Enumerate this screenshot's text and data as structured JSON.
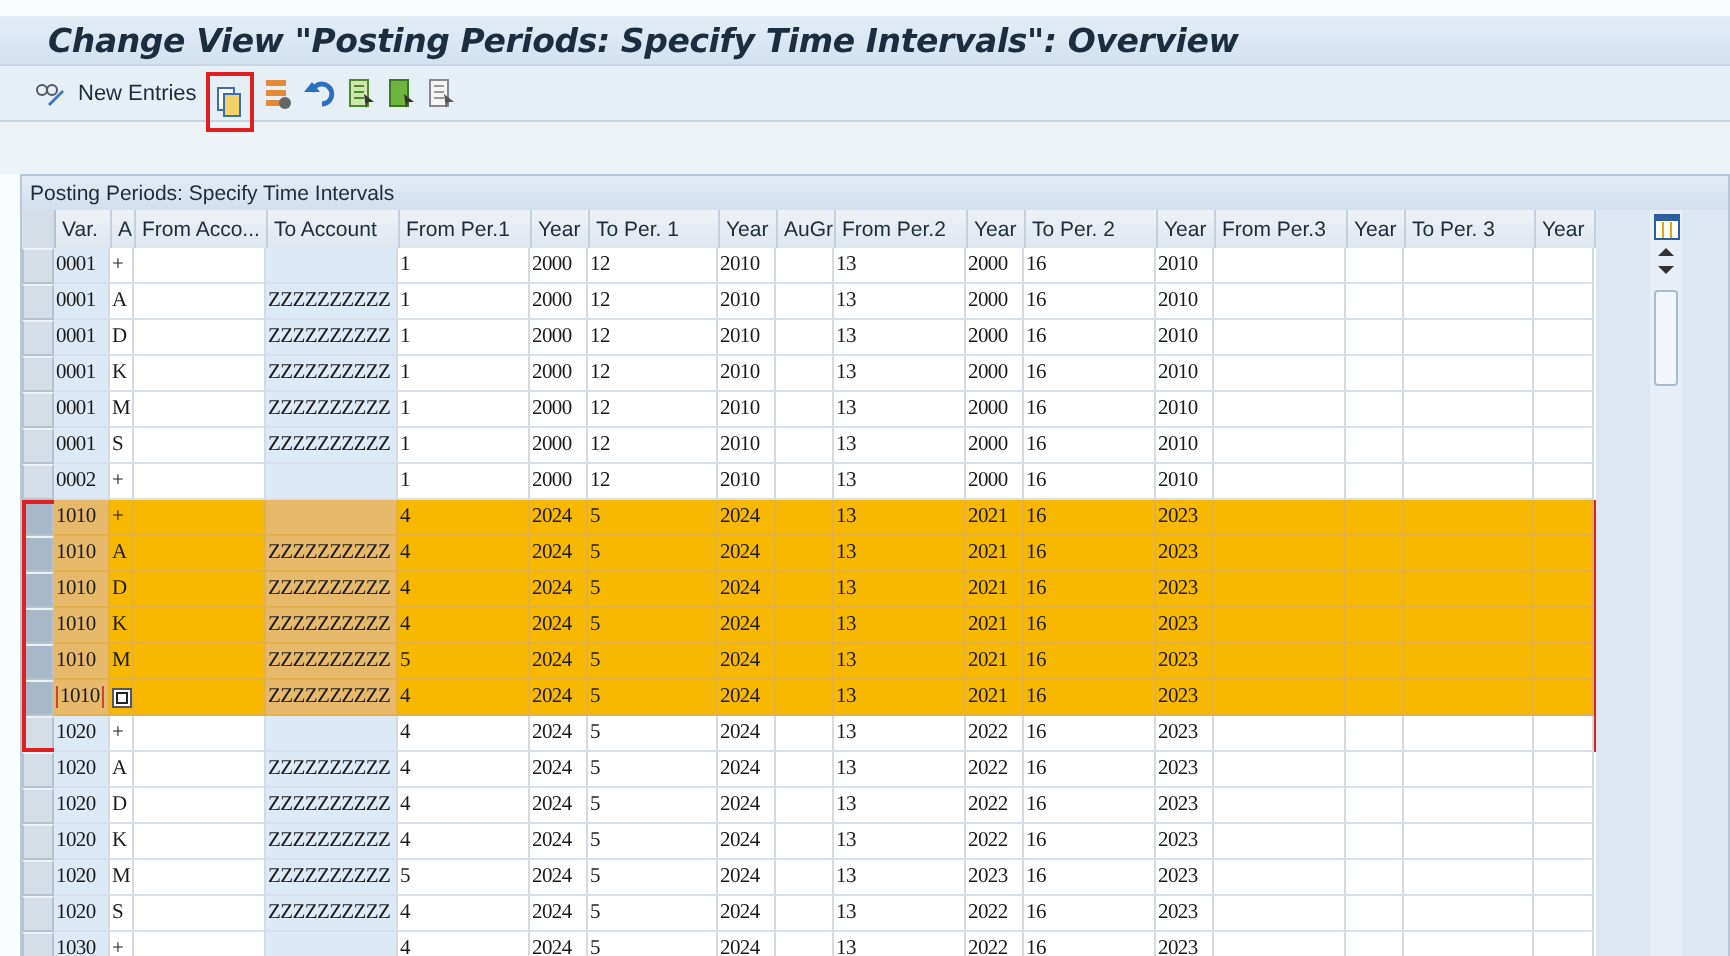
{
  "window": {
    "title": "Change View \"Posting Periods: Specify Time Intervals\": Overview"
  },
  "toolbar": {
    "buttons": [
      {
        "kind": "toggle",
        "highlighted": false
      },
      {
        "kind": "text",
        "label": "New Entries",
        "highlighted": false
      },
      {
        "kind": "copy",
        "highlighted": true
      },
      {
        "kind": "delete",
        "highlighted": false
      },
      {
        "kind": "undo",
        "highlighted": false
      },
      {
        "kind": "select_all",
        "highlighted": false
      },
      {
        "kind": "select_block",
        "highlighted": false
      },
      {
        "kind": "deselect",
        "highlighted": false
      }
    ]
  },
  "table": {
    "title": "Posting Periods: Specify Time Intervals",
    "columns": [
      "Var.",
      "A",
      "From Acco...",
      "To Account",
      "From Per.1",
      "Year",
      "To Per. 1",
      "Year",
      "AuGr",
      "From Per.2",
      "Year",
      "To Per. 2",
      "Year",
      "From Per.3",
      "Year",
      "To Per. 3",
      "Year"
    ],
    "rows": [
      {
        "selected": false,
        "marked": false,
        "focused": false,
        "cells": [
          "0001",
          "+",
          null,
          null,
          "1",
          "2000",
          "12",
          "2010",
          null,
          "13",
          "2000",
          "16",
          "2010",
          null,
          null,
          null,
          null
        ]
      },
      {
        "selected": false,
        "marked": false,
        "focused": false,
        "cells": [
          "0001",
          "A",
          null,
          "ZZZZZZZZZZ",
          "1",
          "2000",
          "12",
          "2010",
          null,
          "13",
          "2000",
          "16",
          "2010",
          null,
          null,
          null,
          null
        ]
      },
      {
        "selected": false,
        "marked": false,
        "focused": false,
        "cells": [
          "0001",
          "D",
          null,
          "ZZZZZZZZZZ",
          "1",
          "2000",
          "12",
          "2010",
          null,
          "13",
          "2000",
          "16",
          "2010",
          null,
          null,
          null,
          null
        ]
      },
      {
        "selected": false,
        "marked": false,
        "focused": false,
        "cells": [
          "0001",
          "K",
          null,
          "ZZZZZZZZZZ",
          "1",
          "2000",
          "12",
          "2010",
          null,
          "13",
          "2000",
          "16",
          "2010",
          null,
          null,
          null,
          null
        ]
      },
      {
        "selected": false,
        "marked": false,
        "focused": false,
        "cells": [
          "0001",
          "M",
          null,
          "ZZZZZZZZZZ",
          "1",
          "2000",
          "12",
          "2010",
          null,
          "13",
          "2000",
          "16",
          "2010",
          null,
          null,
          null,
          null
        ]
      },
      {
        "selected": false,
        "marked": false,
        "focused": false,
        "cells": [
          "0001",
          "S",
          null,
          "ZZZZZZZZZZ",
          "1",
          "2000",
          "12",
          "2010",
          null,
          "13",
          "2000",
          "16",
          "2010",
          null,
          null,
          null,
          null
        ]
      },
      {
        "selected": false,
        "marked": false,
        "focused": false,
        "cells": [
          "0002",
          "+",
          null,
          null,
          "1",
          "2000",
          "12",
          "2010",
          null,
          "13",
          "2000",
          "16",
          "2010",
          null,
          null,
          null,
          null
        ]
      },
      {
        "selected": true,
        "marked": true,
        "focused": false,
        "cells": [
          "1010",
          "+",
          null,
          null,
          "4",
          "2024",
          "5",
          "2024",
          null,
          "13",
          "2021",
          "16",
          "2023",
          null,
          null,
          null,
          null
        ]
      },
      {
        "selected": true,
        "marked": true,
        "focused": false,
        "cells": [
          "1010",
          "A",
          null,
          "ZZZZZZZZZZ",
          "4",
          "2024",
          "5",
          "2024",
          null,
          "13",
          "2021",
          "16",
          "2023",
          null,
          null,
          null,
          null
        ]
      },
      {
        "selected": true,
        "marked": true,
        "focused": false,
        "cells": [
          "1010",
          "D",
          null,
          "ZZZZZZZZZZ",
          "4",
          "2024",
          "5",
          "2024",
          null,
          "13",
          "2021",
          "16",
          "2023",
          null,
          null,
          null,
          null
        ]
      },
      {
        "selected": true,
        "marked": true,
        "focused": false,
        "cells": [
          "1010",
          "K",
          null,
          "ZZZZZZZZZZ",
          "4",
          "2024",
          "5",
          "2024",
          null,
          "13",
          "2021",
          "16",
          "2023",
          null,
          null,
          null,
          null
        ]
      },
      {
        "selected": true,
        "marked": true,
        "focused": false,
        "cells": [
          "1010",
          "M",
          null,
          "ZZZZZZZZZZ",
          "5",
          "2024",
          "5",
          "2024",
          null,
          "13",
          "2021",
          "16",
          "2023",
          null,
          null,
          null,
          null
        ]
      },
      {
        "selected": true,
        "marked": true,
        "focused": true,
        "cells": [
          "1010",
          null,
          null,
          "ZZZZZZZZZZ",
          "4",
          "2024",
          "5",
          "2024",
          null,
          "13",
          "2021",
          "16",
          "2023",
          null,
          null,
          null,
          null
        ]
      },
      {
        "selected": false,
        "marked": true,
        "focused": false,
        "cells": [
          "1020",
          "+",
          null,
          null,
          "4",
          "2024",
          "5",
          "2024",
          null,
          "13",
          "2022",
          "16",
          "2023",
          null,
          null,
          null,
          null
        ]
      },
      {
        "selected": false,
        "marked": false,
        "focused": false,
        "cells": [
          "1020",
          "A",
          null,
          "ZZZZZZZZZZ",
          "4",
          "2024",
          "5",
          "2024",
          null,
          "13",
          "2022",
          "16",
          "2023",
          null,
          null,
          null,
          null
        ]
      },
      {
        "selected": false,
        "marked": false,
        "focused": false,
        "cells": [
          "1020",
          "D",
          null,
          "ZZZZZZZZZZ",
          "4",
          "2024",
          "5",
          "2024",
          null,
          "13",
          "2022",
          "16",
          "2023",
          null,
          null,
          null,
          null
        ]
      },
      {
        "selected": false,
        "marked": false,
        "focused": false,
        "cells": [
          "1020",
          "K",
          null,
          "ZZZZZZZZZZ",
          "4",
          "2024",
          "5",
          "2024",
          null,
          "13",
          "2022",
          "16",
          "2023",
          null,
          null,
          null,
          null
        ]
      },
      {
        "selected": false,
        "marked": false,
        "focused": false,
        "cells": [
          "1020",
          "M",
          null,
          "ZZZZZZZZZZ",
          "5",
          "2024",
          "5",
          "2024",
          null,
          "13",
          "2023",
          "16",
          "2023",
          null,
          null,
          null,
          null
        ]
      },
      {
        "selected": false,
        "marked": false,
        "focused": false,
        "cells": [
          "1020",
          "S",
          null,
          "ZZZZZZZZZZ",
          "4",
          "2024",
          "5",
          "2024",
          null,
          "13",
          "2022",
          "16",
          "2023",
          null,
          null,
          null,
          null
        ]
      },
      {
        "selected": false,
        "marked": false,
        "focused": false,
        "cells": [
          "1030",
          "+",
          null,
          null,
          "4",
          "2024",
          "5",
          "2024",
          null,
          "13",
          "2022",
          "16",
          "2023",
          null,
          null,
          null,
          null
        ]
      }
    ]
  }
}
